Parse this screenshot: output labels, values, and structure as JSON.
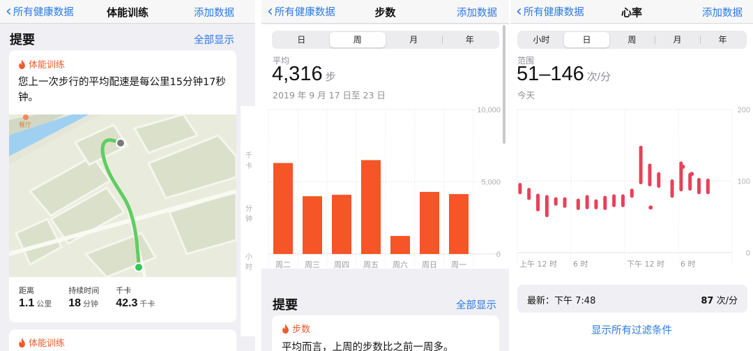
{
  "workout_panel": {
    "nav": {
      "back_label": "所有健康数据",
      "title": "体能训练",
      "add_label": "添加数据"
    },
    "section_title": "提要",
    "show_all_label": "全部显示",
    "card": {
      "tag": "体能训练",
      "message": "您上一次步行的平均配速是每公里15分钟17秒钟。",
      "map_label": "餐厅",
      "stats": [
        {
          "label": "距离",
          "value": "1.1",
          "unit": "公里"
        },
        {
          "label": "持续时间",
          "value": "18",
          "unit": "分钟"
        },
        {
          "label": "千卡",
          "value": "42.3",
          "unit": "千卡"
        }
      ]
    },
    "next_card_tag": "体能训练",
    "peek_labels": [
      "千卡",
      "分钟",
      "小时"
    ]
  },
  "steps_panel": {
    "nav": {
      "back_label": "所有健康数据",
      "title": "步数",
      "add_label": "添加数据"
    },
    "segments": [
      "日",
      "周",
      "月",
      "年"
    ],
    "selected_segment": "周",
    "summary_label": "平均",
    "value": "4,316",
    "unit": "步",
    "date_range": "2019 年 9 月 17 日至 23 日",
    "section_title": "提要",
    "show_all_label": "全部显示",
    "card_tag": "步数",
    "card_text": "平均而言，上周的步数比之前一周多。",
    "bar_color": "#f55527"
  },
  "heart_panel": {
    "nav": {
      "back_label": "所有健康数据",
      "title": "心率",
      "add_label": "添加数据"
    },
    "segments": [
      "小时",
      "日",
      "周",
      "月",
      "年"
    ],
    "selected_segment": "日",
    "summary_label": "范围",
    "value": "51–146",
    "unit": "次/分",
    "date_label": "今天",
    "latest_label": "最新：",
    "latest_time": "下午 7:48",
    "latest_value": "87",
    "latest_unit": "次/分",
    "filter_link": "显示所有过滤条件",
    "accent_color": "#e8415a"
  },
  "chart_data": [
    {
      "type": "bar",
      "categories": [
        "周二",
        "周三",
        "周四",
        "周五",
        "周六",
        "周日",
        "周一"
      ],
      "values": [
        6300,
        4000,
        4100,
        6500,
        1250,
        4300,
        4150
      ],
      "ylim": [
        0,
        10000
      ],
      "yticks": [
        "0",
        "5,000",
        "10,000"
      ],
      "grid": true
    },
    {
      "type": "range",
      "x_labels": [
        "上午 12 时",
        "6 时",
        "下午 12 时",
        "6 时"
      ],
      "y_ticks": [
        "0",
        "100",
        "200"
      ],
      "ylim": [
        0,
        200
      ],
      "series": [
        {
          "name": "",
          "ranges": [
            [
              84,
              95
            ],
            [
              76,
              88
            ],
            [
              60,
              80
            ],
            [
              52,
              78
            ],
            [
              68,
              75
            ],
            [
              65,
              75
            ],
            [
              62,
              73
            ],
            [
              63,
              78
            ],
            [
              63,
              72
            ],
            [
              62,
              77
            ],
            [
              66,
              79
            ],
            [
              66,
              79
            ],
            [
              79,
              87
            ],
            [
              98,
              147
            ],
            [
              95,
              122
            ],
            [
              93,
              110
            ],
            [
              79,
              100
            ],
            [
              88,
              125
            ],
            [
              89,
              109
            ],
            [
              84,
              102
            ],
            [
              84,
              101
            ]
          ],
          "points": [
            [
              14.6,
              63
            ],
            [
              18.2,
              120
            ],
            [
              19.2,
              110
            ]
          ]
        }
      ]
    }
  ]
}
